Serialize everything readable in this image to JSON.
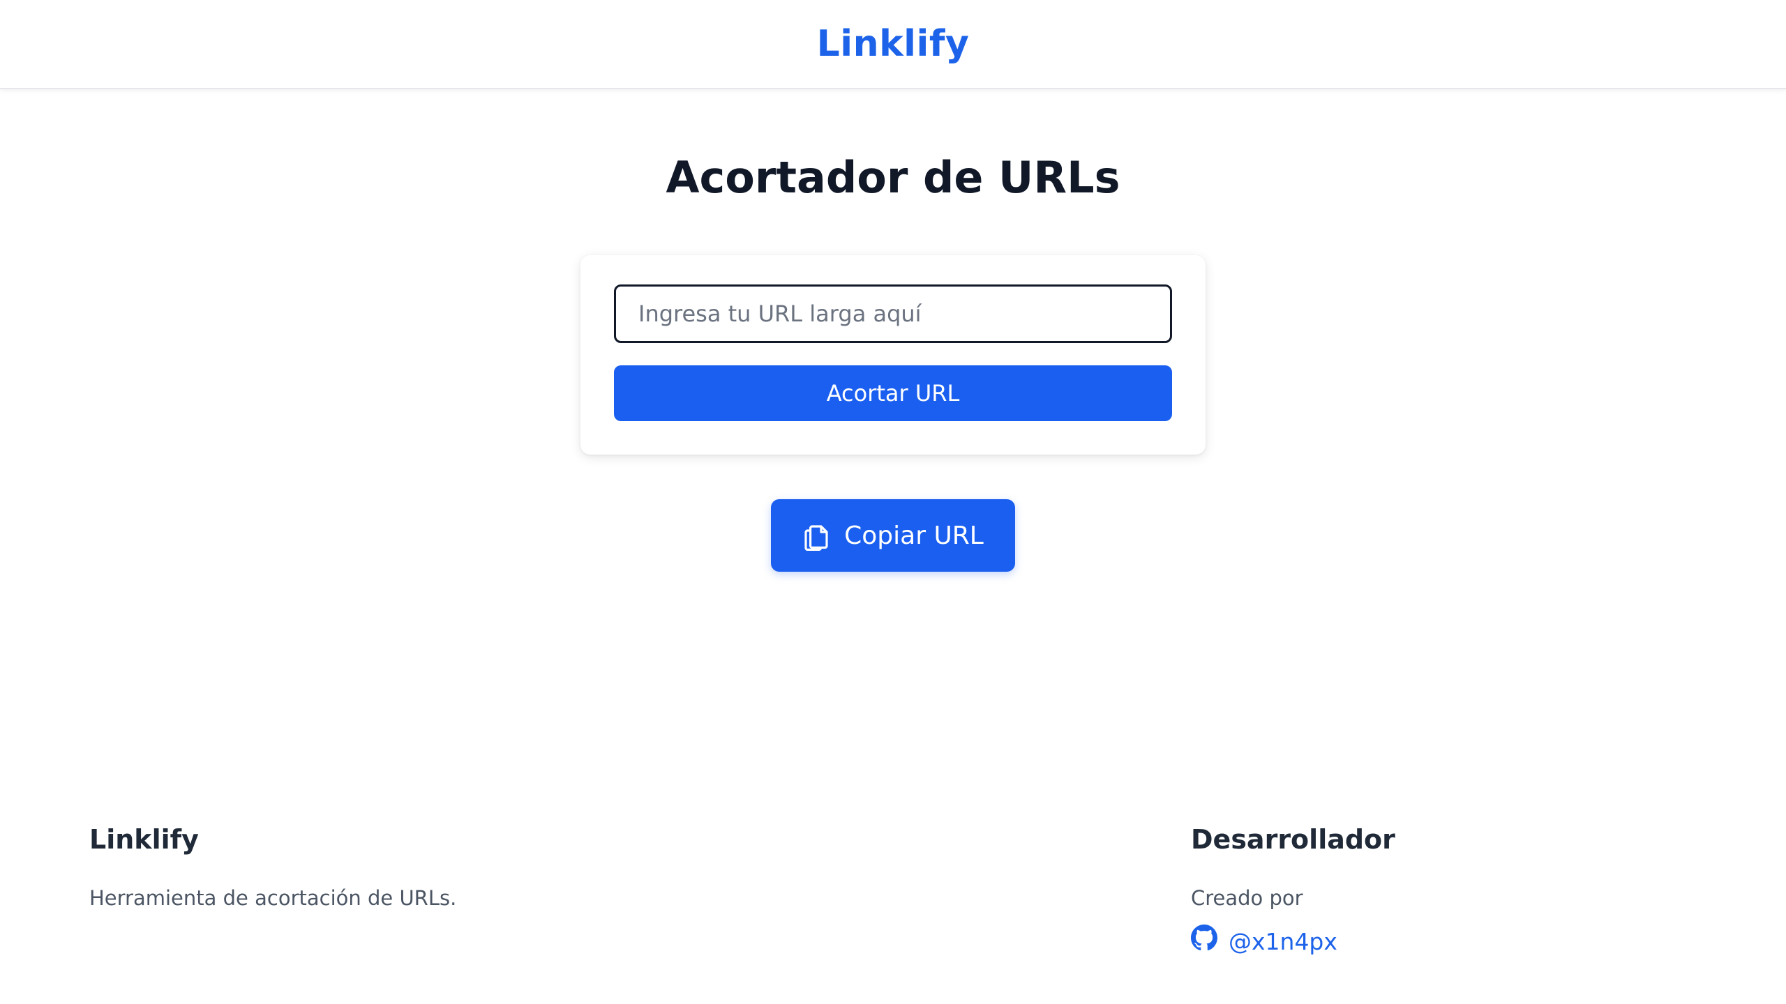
{
  "header": {
    "brand": "Linklify"
  },
  "main": {
    "title": "Acortador de URLs",
    "url_input": {
      "value": "",
      "placeholder": "Ingresa tu URL larga aquí"
    },
    "shorten_button_label": "Acortar URL",
    "copy_button": {
      "label": "Copiar URL",
      "icon": "copy-icon"
    }
  },
  "footer": {
    "about": {
      "heading": "Linklify",
      "description": "Herramienta de acortación de URLs."
    },
    "developer": {
      "heading": "Desarrollador",
      "created_by": "Creado por",
      "handle": "@x1n4px",
      "icon": "github-icon"
    }
  },
  "colors": {
    "brand": "#1d63ea",
    "primary_button": "#1a5ff0",
    "text_dark": "#111827",
    "text_muted": "#4b5563"
  }
}
